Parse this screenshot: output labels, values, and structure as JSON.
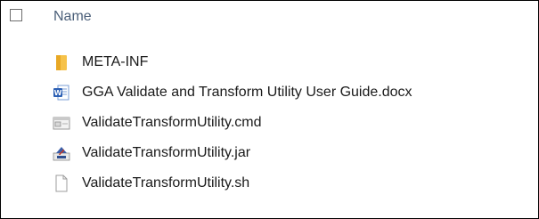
{
  "header": {
    "column_name": "Name"
  },
  "files": [
    {
      "name": "META-INF",
      "icon": "folder-icon"
    },
    {
      "name": "GGA Validate and Transform Utility User Guide.docx",
      "icon": "word-document-icon"
    },
    {
      "name": "ValidateTransformUtility.cmd",
      "icon": "command-script-icon"
    },
    {
      "name": "ValidateTransformUtility.jar",
      "icon": "java-archive-icon"
    },
    {
      "name": "ValidateTransformUtility.sh",
      "icon": "generic-file-icon"
    }
  ],
  "colors": {
    "header_text": "#4c607a",
    "folder": "#f6c24a",
    "word_blue": "#2b5fb4"
  }
}
